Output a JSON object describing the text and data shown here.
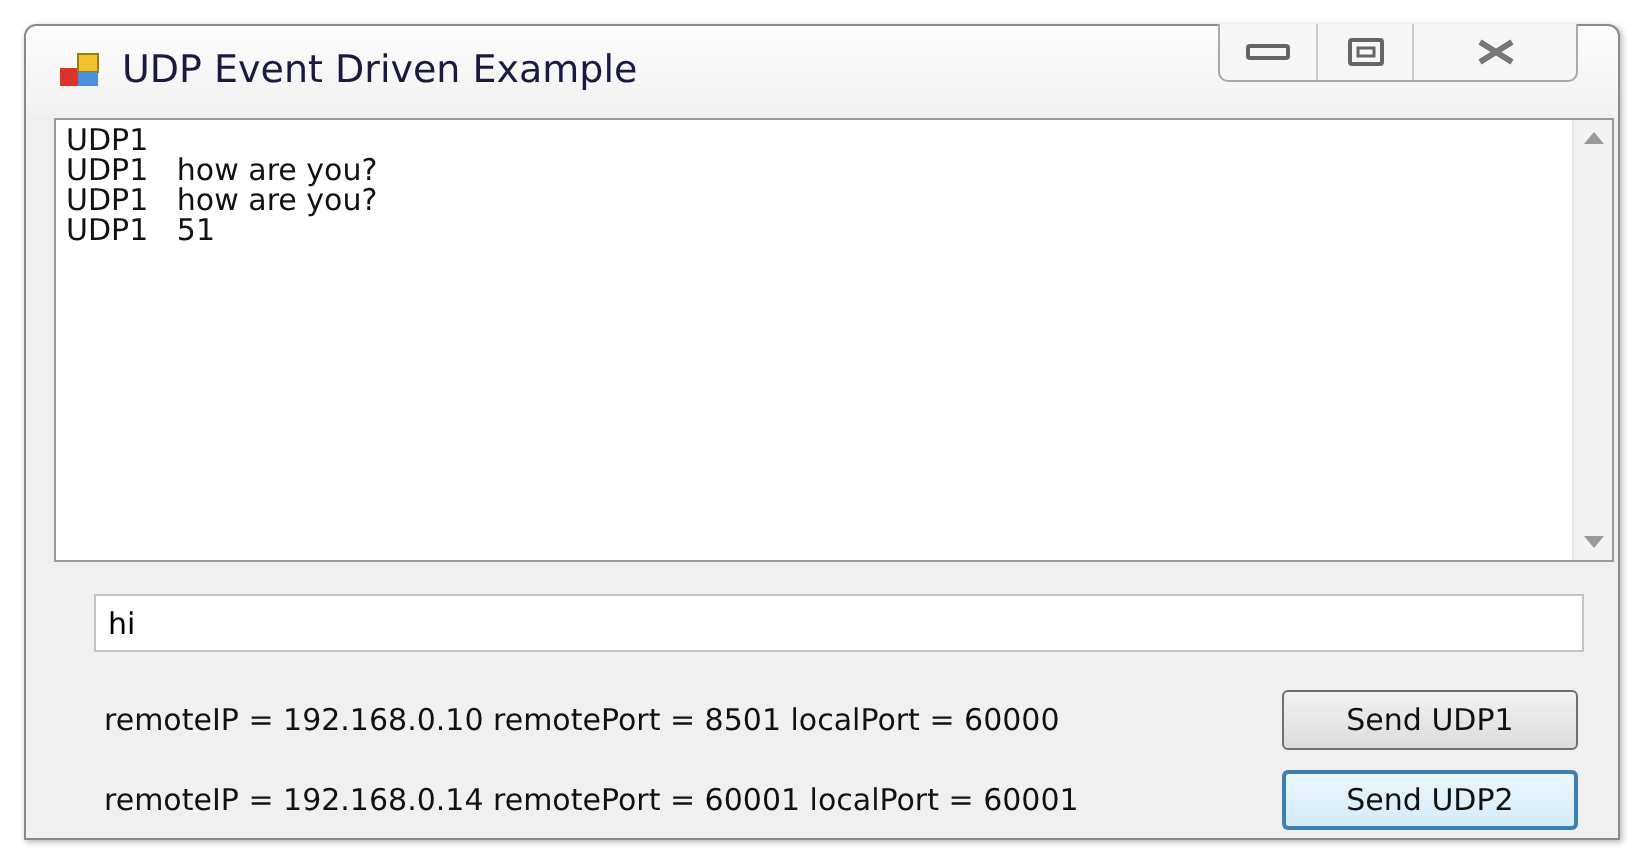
{
  "window": {
    "title": "UDP Event Driven Example"
  },
  "log_lines": [
    "UDP1",
    "UDP1   how are you?",
    "UDP1   how are you?",
    "UDP1   51"
  ],
  "message_field": {
    "value": "hi"
  },
  "connections": [
    {
      "label": "remoteIP = 192.168.0.10 remotePort = 8501 localPort = 60000",
      "button": "Send UDP1",
      "focused": false
    },
    {
      "label": "remoteIP = 192.168.0.14 remotePort = 60001 localPort = 60001",
      "button": "Send UDP2",
      "focused": true
    }
  ]
}
